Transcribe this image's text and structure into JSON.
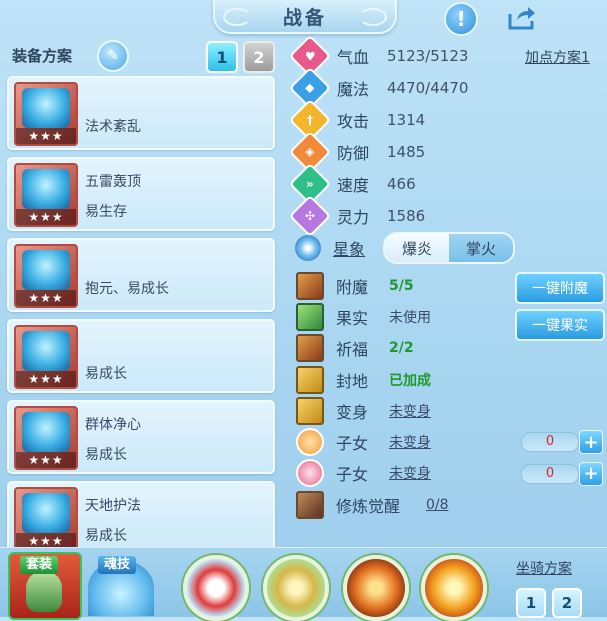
{
  "header": {
    "title": "战备",
    "info_icon": "exclamation-icon",
    "share_icon": "share-icon"
  },
  "equip": {
    "title": "装备方案",
    "plans": [
      "1",
      "2"
    ],
    "active_plan": "1",
    "items": [
      {
        "name": "",
        "tag": "法术紊乱",
        "stars": "★★★"
      },
      {
        "name": "五雷轰顶",
        "tag": "易生存",
        "stars": "★★★"
      },
      {
        "name": "",
        "tag": "抱元、易成长",
        "stars": "★★★"
      },
      {
        "name": "",
        "tag": "易成长",
        "stars": "★★★"
      },
      {
        "name": "群体净心",
        "tag": "易成长",
        "stars": "★★★"
      },
      {
        "name": "天地护法",
        "tag": "易成长",
        "stars": "★★★"
      }
    ]
  },
  "stats": {
    "plan_label": "加点方案1",
    "rows": [
      {
        "label": "气血",
        "value": "5123/5123",
        "icon": "heart-icon",
        "color": "#e8588a"
      },
      {
        "label": "魔法",
        "value": "4470/4470",
        "icon": "mana-icon",
        "color": "#3aa0e6"
      },
      {
        "label": "攻击",
        "value": "1314",
        "icon": "sword-icon",
        "color": "#f2b52b"
      },
      {
        "label": "防御",
        "value": "1485",
        "icon": "shield-icon",
        "color": "#f28a3c"
      },
      {
        "label": "速度",
        "value": "466",
        "icon": "speed-icon",
        "color": "#2fc08a"
      },
      {
        "label": "灵力",
        "value": "1586",
        "icon": "spirit-icon",
        "color": "#b777e0"
      }
    ]
  },
  "xingxiang": {
    "label": "星象",
    "options": [
      "爆炎",
      "掌火"
    ],
    "selected": "爆炎"
  },
  "buffs": [
    {
      "label": "附魔",
      "value": "5/5",
      "button": "一键附魔"
    },
    {
      "label": "果实",
      "value": "未使用",
      "button": "一键果实"
    },
    {
      "label": "祈福",
      "value": "2/2"
    },
    {
      "label": "封地",
      "value": "已加成"
    },
    {
      "label": "变身",
      "value": "未变身"
    },
    {
      "label": "子女",
      "value": "未变身",
      "counter": "0"
    },
    {
      "label": "子女",
      "value": "未变身",
      "counter": "0"
    },
    {
      "label": "修炼觉醒",
      "value": "0/8"
    }
  ],
  "bottom": {
    "suit_label": "套装",
    "soul_label": "魂技",
    "mount_title": "坐骑方案",
    "mount_plans": [
      "1",
      "2"
    ]
  }
}
